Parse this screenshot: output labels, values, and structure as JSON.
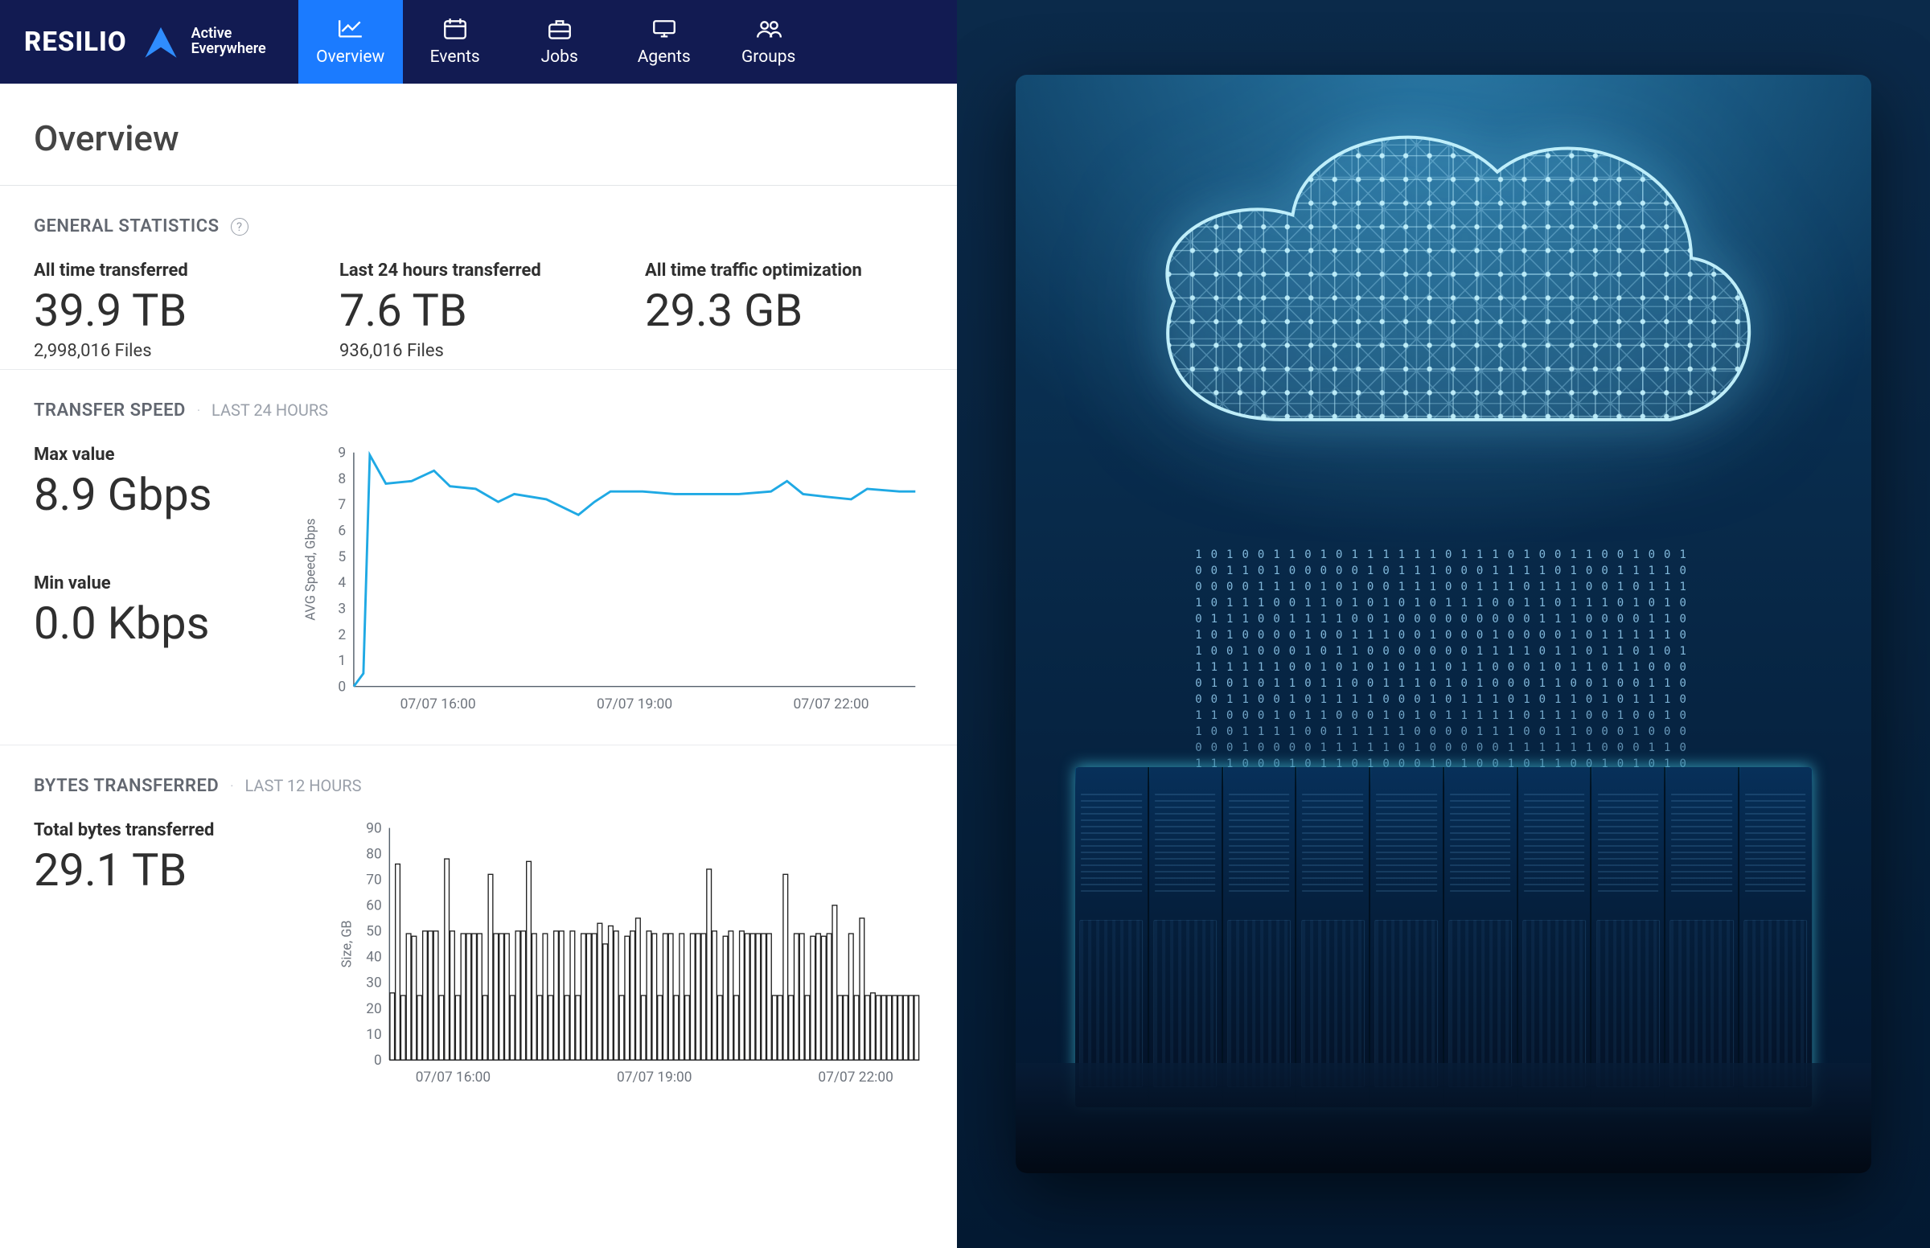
{
  "brand": {
    "name": "RESILIO",
    "tagline_1": "Active",
    "tagline_2": "Everywhere"
  },
  "nav": {
    "items": [
      {
        "label": "Overview",
        "active": true
      },
      {
        "label": "Events",
        "active": false
      },
      {
        "label": "Jobs",
        "active": false
      },
      {
        "label": "Agents",
        "active": false
      },
      {
        "label": "Groups",
        "active": false
      }
    ]
  },
  "page": {
    "title": "Overview"
  },
  "general": {
    "title": "GENERAL STATISTICS",
    "all_time_label": "All time transferred",
    "all_time_value": "39.9 TB",
    "all_time_files": "2,998,016 Files",
    "last24_label": "Last 24 hours transferred",
    "last24_value": "7.6 TB",
    "last24_files": "936,016 Files",
    "opt_label": "All time traffic optimization",
    "opt_value": "29.3 GB"
  },
  "speed": {
    "title": "TRANSFER SPEED",
    "range": "LAST 24 HOURS",
    "max_label": "Max value",
    "max_value": "8.9 Gbps",
    "min_label": "Min value",
    "min_value": "0.0 Kbps",
    "ylabel": "AVG Speed, Gbps",
    "yticks": [
      "0",
      "1",
      "2",
      "3",
      "4",
      "5",
      "6",
      "7",
      "8",
      "9"
    ],
    "xticks": [
      "07/07 16:00",
      "07/07 19:00",
      "07/07 22:00"
    ]
  },
  "bytes": {
    "title": "BYTES TRANSFERRED",
    "range": "LAST 12 HOURS",
    "total_label": "Total bytes transferred",
    "total_value": "29.1 TB",
    "ylabel": "Size, GB",
    "yticks": [
      "0",
      "10",
      "20",
      "30",
      "40",
      "50",
      "60",
      "70",
      "80",
      "90"
    ],
    "xticks": [
      "07/07 16:00",
      "07/07 19:00",
      "07/07 22:00"
    ]
  },
  "chart_data": [
    {
      "type": "line",
      "title": "TRANSFER SPEED",
      "ylabel": "AVG Speed, Gbps",
      "ylim": [
        0,
        9
      ],
      "x": [
        0,
        0.3,
        0.5,
        1,
        1.8,
        2.5,
        3,
        3.8,
        4.5,
        5,
        6,
        7,
        7.5,
        8,
        9,
        10,
        11,
        12,
        13,
        13.5,
        14,
        14.7,
        15.5,
        16,
        17,
        17.5
      ],
      "xtick_labels": [
        "07/07 16:00",
        "07/07 19:00",
        "07/07 22:00"
      ],
      "values": [
        0.0,
        0.5,
        8.9,
        7.8,
        7.9,
        8.3,
        7.7,
        7.6,
        7.1,
        7.4,
        7.2,
        6.6,
        7.1,
        7.5,
        7.5,
        7.4,
        7.4,
        7.4,
        7.5,
        7.9,
        7.4,
        7.3,
        7.2,
        7.6,
        7.5,
        7.5
      ]
    },
    {
      "type": "bar",
      "title": "BYTES TRANSFERRED",
      "ylabel": "Size, GB",
      "ylim": [
        0,
        90
      ],
      "xtick_labels": [
        "07/07 16:00",
        "07/07 19:00",
        "07/07 22:00"
      ],
      "values": [
        26,
        76,
        25,
        49,
        48,
        25,
        50,
        50,
        50,
        25,
        78,
        50,
        25,
        49,
        49,
        49,
        49,
        25,
        72,
        49,
        49,
        49,
        25,
        50,
        50,
        77,
        49,
        25,
        49,
        25,
        50,
        50,
        25,
        50,
        25,
        49,
        49,
        49,
        53,
        45,
        52,
        50,
        25,
        48,
        50,
        55,
        25,
        50,
        49,
        25,
        49,
        49,
        25,
        49,
        25,
        49,
        49,
        49,
        74,
        50,
        25,
        48,
        50,
        25,
        50,
        49,
        49,
        49,
        49,
        49,
        25,
        25,
        72,
        25,
        49,
        49,
        25,
        48,
        49,
        48,
        49,
        60,
        25,
        25,
        49,
        25,
        55,
        25,
        26,
        25,
        25,
        25,
        25,
        25,
        25,
        25,
        25
      ]
    }
  ]
}
